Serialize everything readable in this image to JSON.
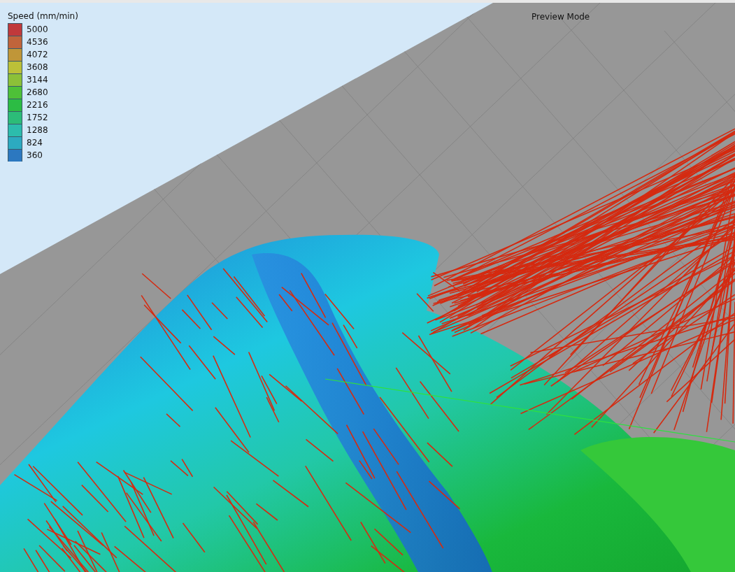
{
  "legend": {
    "title": "Speed (mm/min)",
    "items": [
      {
        "label": "5000",
        "color": "#c0393b"
      },
      {
        "label": "4536",
        "color": "#c0643b"
      },
      {
        "label": "4072",
        "color": "#c09638"
      },
      {
        "label": "3608",
        "color": "#bcc038"
      },
      {
        "label": "3144",
        "color": "#8cc038"
      },
      {
        "label": "2680",
        "color": "#4ec038"
      },
      {
        "label": "2216",
        "color": "#2cbc44"
      },
      {
        "label": "1752",
        "color": "#2cbc78"
      },
      {
        "label": "1288",
        "color": "#2cbcac"
      },
      {
        "label": "824",
        "color": "#2caac0"
      },
      {
        "label": "360",
        "color": "#2c78c0"
      }
    ]
  },
  "mode_label": "Preview Mode"
}
